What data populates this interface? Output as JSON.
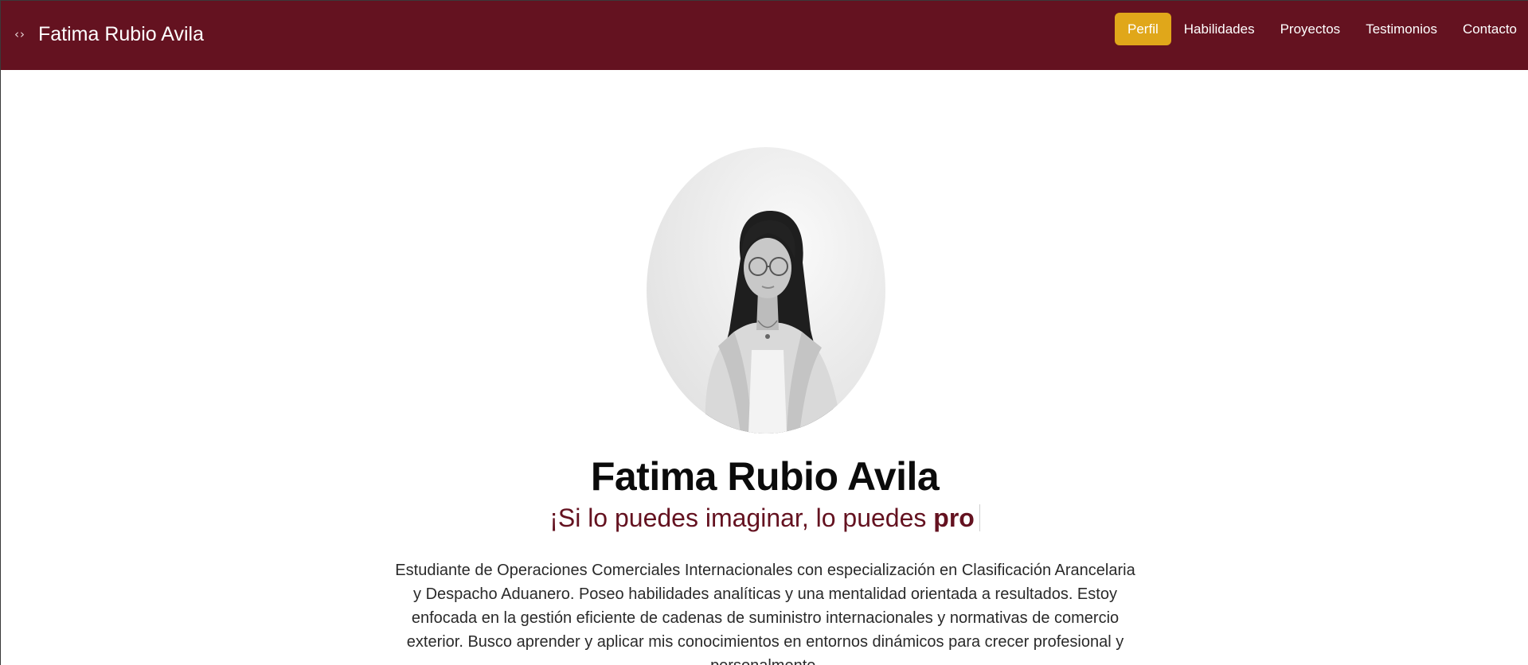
{
  "header": {
    "brand_icon": "‹›",
    "brand_name": "Fatima Rubio Avila",
    "nav": [
      {
        "label": "Perfil",
        "active": true
      },
      {
        "label": "Habilidades",
        "active": false
      },
      {
        "label": "Proyectos",
        "active": false
      },
      {
        "label": "Testimonios",
        "active": false
      },
      {
        "label": "Contacto",
        "active": false
      }
    ]
  },
  "hero": {
    "photo_alt": "Profile photo",
    "name": "Fatima Rubio Avila",
    "tagline_prefix": "¡Si lo puedes imaginar, lo puedes ",
    "tagline_typed": "pro",
    "bio": "Estudiante de Operaciones Comerciales Internacionales con especialización en Clasificación Arancelaria y Despacho Aduanero. Poseo habilidades analíticas y una mentalidad orientada a resultados. Estoy enfocada en la gestión eficiente de cadenas de suministro internacionales y normativas de comercio exterior. Busco aprender y aplicar mis conocimientos en entornos dinámicos para crecer profesional y personalmente."
  },
  "colors": {
    "header_bg": "#641220",
    "active_nav_bg": "#e0a71a",
    "tagline": "#641220",
    "text": "#2a2a2a"
  }
}
